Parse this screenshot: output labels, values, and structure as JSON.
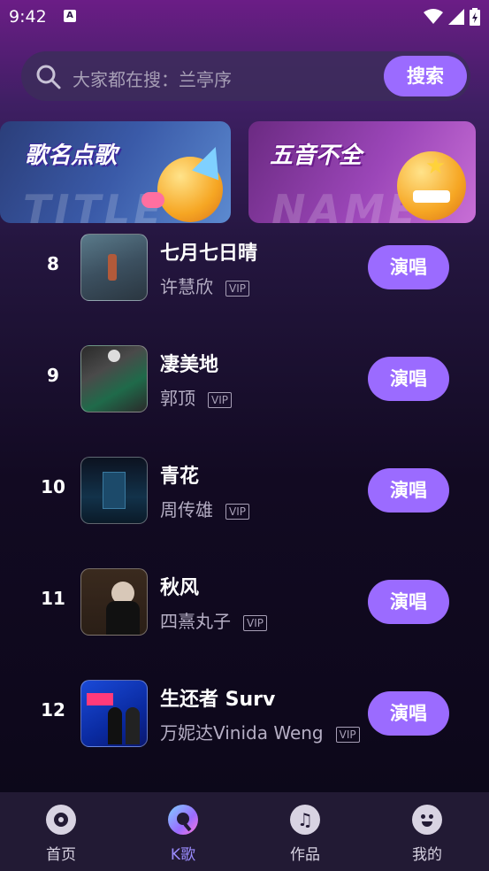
{
  "status": {
    "time": "9:42",
    "a_icon": "A"
  },
  "search": {
    "placeholder": "大家都在搜：兰亭序",
    "button_label": "搜索"
  },
  "banners": [
    {
      "title": "歌名点歌",
      "bg_text": "TITLE"
    },
    {
      "title": "五音不全",
      "bg_text": "NAME"
    }
  ],
  "songs": [
    {
      "rank": "8",
      "title": "七月七日晴",
      "artist": "许慧欣",
      "badge": "VIP",
      "action": "演唱"
    },
    {
      "rank": "9",
      "title": "凄美地",
      "artist": "郭顶",
      "badge": "VIP",
      "action": "演唱"
    },
    {
      "rank": "10",
      "title": "青花",
      "artist": "周传雄",
      "badge": "VIP",
      "action": "演唱"
    },
    {
      "rank": "11",
      "title": "秋风",
      "artist": "四熹丸子",
      "badge": "VIP",
      "action": "演唱"
    },
    {
      "rank": "12",
      "title": "生还者 Surv",
      "artist": "万妮达Vinida Weng",
      "badge": "VIP",
      "action": "演唱"
    }
  ],
  "nav": [
    {
      "label": "首页",
      "icon": "home-disc-icon"
    },
    {
      "label": "K歌",
      "icon": "karaoke-mic-icon",
      "active": true
    },
    {
      "label": "作品",
      "icon": "music-note-icon"
    },
    {
      "label": "我的",
      "icon": "profile-face-icon"
    }
  ],
  "colors": {
    "accent": "#9b6bff",
    "nav_active": "#9b8cff"
  }
}
